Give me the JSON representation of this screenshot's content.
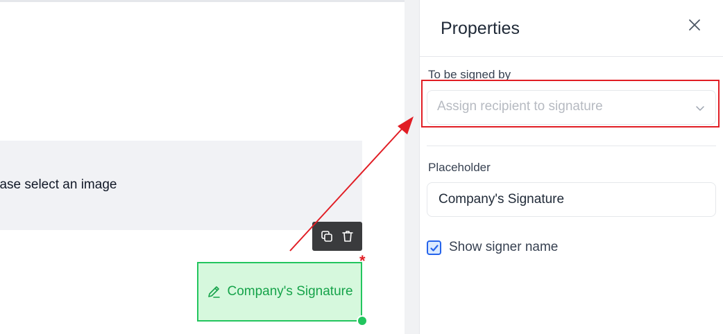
{
  "canvas": {
    "image_placeholder_text": "Please select an image",
    "signature_field": {
      "label": "Company's Signature",
      "required_marker": "*",
      "color": "#22c55e",
      "fill": "#d6f8dd"
    },
    "toolbar": {
      "duplicate_icon": "copy-icon",
      "delete_icon": "trash-icon"
    }
  },
  "panel": {
    "title": "Properties",
    "close_icon": "close-icon",
    "signed_by": {
      "label": "To be signed by",
      "placeholder": "Assign recipient to signature"
    },
    "placeholder_field": {
      "label": "Placeholder",
      "value": "Company's Signature"
    },
    "show_signer_name": {
      "label": "Show signer name",
      "checked": true
    }
  },
  "annotation": {
    "highlight_color": "#e11d24"
  }
}
